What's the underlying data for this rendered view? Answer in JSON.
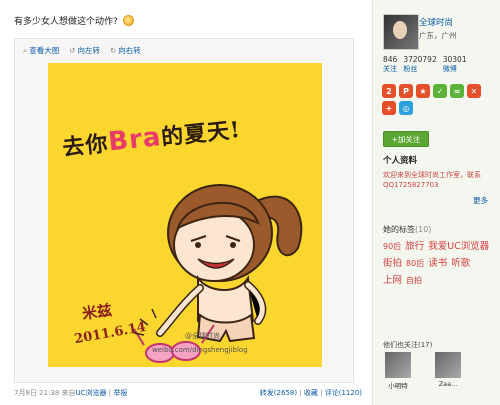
{
  "post": {
    "text": "有多少女人想做这个动作?",
    "toolbar": {
      "view_large": "查看大图",
      "rotate_left": "向左转",
      "rotate_right": "向右转"
    },
    "image": {
      "headline_pre": "去你",
      "headline_bra": "Bra",
      "headline_post": "的夏天!",
      "sign_name": "米兹",
      "sign_date": "2011.6.14",
      "watermark_name": "@全球时尚",
      "watermark_url": "weibo.com/dingshengjiblog"
    },
    "meta": {
      "time": "7月8日 21:38",
      "from_prefix": "来自",
      "source": "UC浏览器",
      "report": "举报"
    },
    "actions": {
      "repost": "转发(2658)",
      "favorite": "收藏",
      "comment": "评论(1120)"
    }
  },
  "sidebar": {
    "user_name": "全球时尚",
    "location": "广东，广州",
    "stats": [
      {
        "value": "846",
        "label": "关注"
      },
      {
        "value": "3720792",
        "label": "粉丝"
      },
      {
        "value": "30301",
        "label": "微博"
      }
    ],
    "badges": [
      {
        "text": "2",
        "color": "#e4502a"
      },
      {
        "text": "P",
        "color": "#e4502a"
      },
      {
        "text": "★",
        "color": "#e4502a"
      },
      {
        "text": "✓",
        "color": "#5cb33a"
      },
      {
        "text": "≈",
        "color": "#5cb33a"
      },
      {
        "text": "✕",
        "color": "#e4502a"
      },
      {
        "text": "+",
        "color": "#e4502a"
      },
      {
        "text": "◎",
        "color": "#2aa0dc"
      }
    ],
    "follow_label": "+加关注",
    "profile_title": "个人资料",
    "profile_text": "欢迎来到全球时尚工作室，联系QQ1725827703",
    "more": "更多",
    "tags_title": "她的标签",
    "tags_count": "(10)",
    "tags": [
      {
        "text": "90后",
        "size": 1
      },
      {
        "text": "旅行",
        "size": 2
      },
      {
        "text": "我爱UC浏览器",
        "size": 2
      },
      {
        "text": "街拍",
        "size": 2
      },
      {
        "text": "80后",
        "size": 1
      },
      {
        "text": "读书",
        "size": 2
      },
      {
        "text": "听歌",
        "size": 2
      },
      {
        "text": "上网",
        "size": 2
      },
      {
        "text": "自拍",
        "size": 1
      }
    ],
    "friends_title": "他们也关注(17)",
    "friends": [
      {
        "name": "小明特"
      },
      {
        "name": "Zaa..."
      }
    ]
  }
}
